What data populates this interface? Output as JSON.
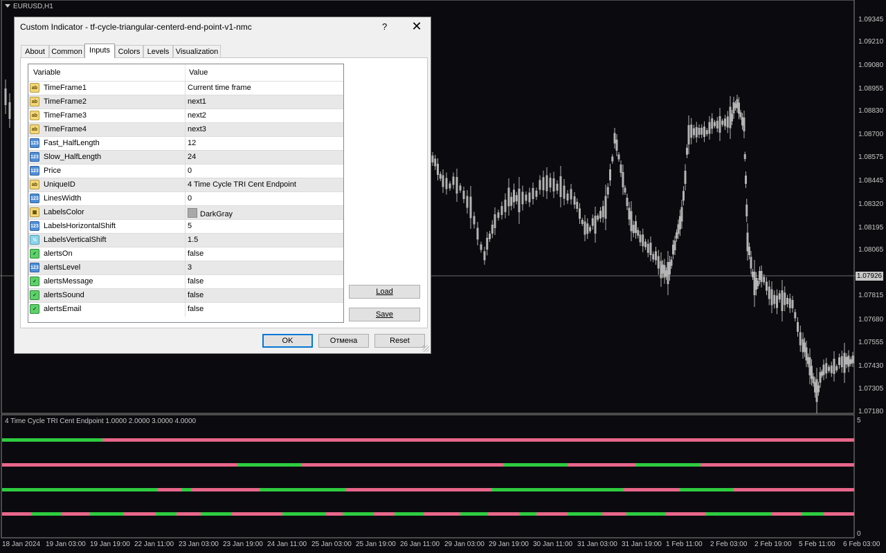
{
  "chart": {
    "symbol": "EURUSD,H1",
    "indicator_label": "4 Time Cycle TRI Cent Endpoint  1.0000 2.0000 3.0000 4.0000",
    "price_labels": [
      "1.09345",
      "1.09210",
      "1.09080",
      "1.08955",
      "1.08830",
      "1.08700",
      "1.08575",
      "1.08445",
      "1.08320",
      "1.08195",
      "1.08065",
      "1.07815",
      "1.07680",
      "1.07555",
      "1.07430",
      "1.07305",
      "1.07180"
    ],
    "current_price": "1.07926",
    "subwindow_scale_top": "5",
    "subwindow_scale_bottom": "0",
    "time_labels": [
      "18 Jan 2024",
      "19 Jan 03:00",
      "19 Jan 19:00",
      "22 Jan 11:00",
      "23 Jan 03:00",
      "23 Jan 19:00",
      "24 Jan 11:00",
      "25 Jan 03:00",
      "25 Jan 19:00",
      "26 Jan 11:00",
      "29 Jan 03:00",
      "29 Jan 19:00",
      "30 Jan 11:00",
      "31 Jan 03:00",
      "31 Jan 19:00",
      "1 Feb 11:00",
      "2 Feb 03:00",
      "2 Feb 19:00",
      "5 Feb 11:00",
      "6 Feb 03:00"
    ],
    "colors": {
      "bull_line": "#2ecc40",
      "bear_line": "#e8668a",
      "candles": "#b4b4b4",
      "background": "#0b0b0f"
    }
  },
  "dialog": {
    "title": "Custom Indicator - tf-cycle-triangular-centerd-end-point-v1-nmc",
    "help": "?",
    "close": "✕",
    "tabs": [
      {
        "label": "About"
      },
      {
        "label": "Common"
      },
      {
        "label": "Inputs",
        "active": true
      },
      {
        "label": "Colors"
      },
      {
        "label": "Levels"
      },
      {
        "label": "Visualization"
      }
    ],
    "grid": {
      "col_variable": "Variable",
      "col_value": "Value",
      "rows": [
        {
          "icon": "ab",
          "type": "str",
          "name": "TimeFrame1",
          "value": "Current time frame"
        },
        {
          "icon": "ab",
          "type": "str",
          "name": "TimeFrame2",
          "value": "next1"
        },
        {
          "icon": "ab",
          "type": "str",
          "name": "TimeFrame3",
          "value": "next2"
        },
        {
          "icon": "ab",
          "type": "str",
          "name": "TimeFrame4",
          "value": "next3"
        },
        {
          "icon": "123",
          "type": "int",
          "name": "Fast_HalfLength",
          "value": "12"
        },
        {
          "icon": "123",
          "type": "int",
          "name": "Slow_HalfLength",
          "value": "24"
        },
        {
          "icon": "123",
          "type": "int",
          "name": "Price",
          "value": "0"
        },
        {
          "icon": "ab",
          "type": "str",
          "name": "UniqueID",
          "value": "4 Time Cycle TRI Cent Endpoint"
        },
        {
          "icon": "123",
          "type": "int",
          "name": "LinesWidth",
          "value": "0"
        },
        {
          "icon": "▦",
          "type": "color",
          "name": "LabelsColor",
          "value": "DarkGray"
        },
        {
          "icon": "123",
          "type": "int",
          "name": "LabelsHorizontalShift",
          "value": "5"
        },
        {
          "icon": "½",
          "type": "dbl",
          "name": "LabelsVerticalShift",
          "value": "1.5"
        },
        {
          "icon": "✓",
          "type": "bool",
          "name": "alertsOn",
          "value": "false"
        },
        {
          "icon": "123",
          "type": "int",
          "name": "alertsLevel",
          "value": "3"
        },
        {
          "icon": "✓",
          "type": "bool",
          "name": "alertsMessage",
          "value": "false"
        },
        {
          "icon": "✓",
          "type": "bool",
          "name": "alertsSound",
          "value": "false"
        },
        {
          "icon": "✓",
          "type": "bool",
          "name": "alertsEmail",
          "value": "false"
        }
      ]
    },
    "buttons": {
      "load": "Load",
      "save": "Save",
      "ok": "OK",
      "cancel": "Отмена",
      "reset": "Reset"
    }
  }
}
